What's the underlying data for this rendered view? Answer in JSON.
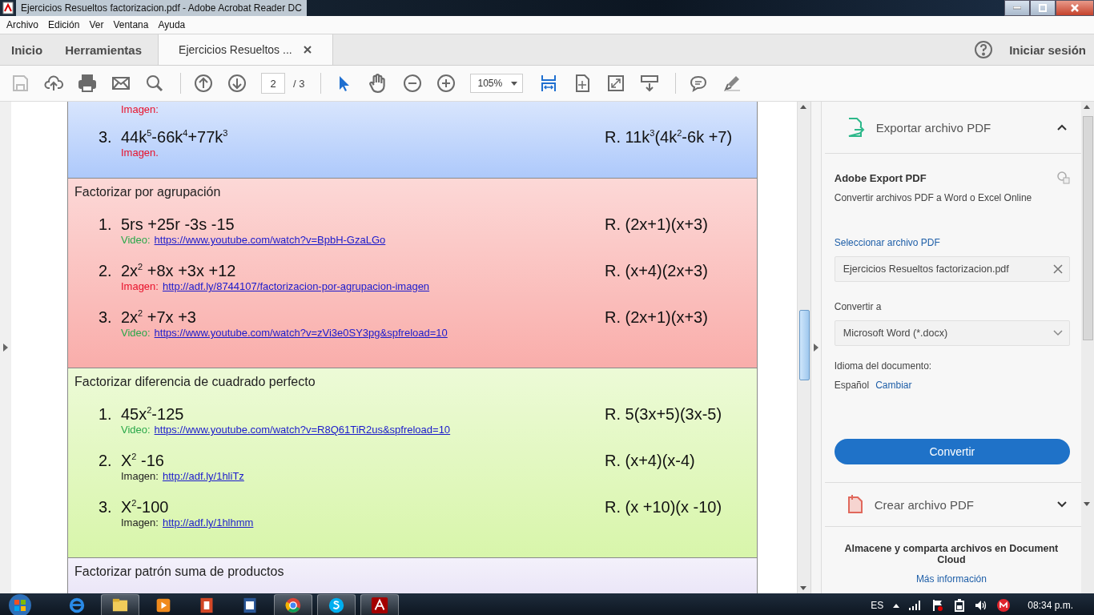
{
  "window": {
    "title": "Ejercicios Resueltos factorizacion.pdf - Adobe Acrobat Reader DC"
  },
  "menu": [
    "Archivo",
    "Edición",
    "Ver",
    "Ventana",
    "Ayuda"
  ],
  "tabs": [
    {
      "label": "Inicio",
      "selected": false
    },
    {
      "label": "Herramientas",
      "selected": false
    },
    {
      "label": "Ejercicios Resueltos ...",
      "selected": true
    }
  ],
  "sign_in": "Iniciar sesión",
  "toolbar": {
    "page": "2",
    "page_total": "/ 3",
    "zoom": "105%"
  },
  "document": {
    "sections": [
      {
        "color": "#a9c6fb",
        "items": [
          {
            "link_label": "Imagen:",
            "color": "#e8102a"
          },
          {
            "number": "3.",
            "formula": "44k$^{5}$-66k$^{4}$+77k$^{3}$",
            "answer": "R. 11k$^{3}$(4k$^{2}$-6k +7)",
            "link_label": "Imagen.",
            "color": "#e8102a"
          }
        ]
      },
      {
        "color": "#f9a9a6",
        "title": "Factorizar por agrupación",
        "items": [
          {
            "number": "1.",
            "formula": "5rs +25r -3s -15",
            "answer": "R. (2x+1)(x+3)",
            "link_label": "Video:",
            "color": "#2aa84a",
            "url": "https://www.youtube.com/watch?v=BpbH-GzaLGo"
          },
          {
            "number": "2.",
            "formula": "2x$^{2}$ +8x +3x +12",
            "answer": "R. (x+4)(2x+3)",
            "link_label": "Imagen:",
            "color": "#e8102a",
            "url": "http://adf.ly/8744107/factorizacion-por-agrupacion-imagen"
          },
          {
            "number": "3.",
            "formula": "2x$^{2}$ +7x +3",
            "answer": "R. (2x+1)(x+3)",
            "link_label": "Video:",
            "color": "#2aa84a",
            "url": "https://www.youtube.com/watch?v=zVi3e0SY3pg&spfreload=10"
          }
        ]
      },
      {
        "color": "#d6f5a6",
        "title": "Factorizar diferencia de cuadrado perfecto",
        "items": [
          {
            "number": "1.",
            "formula": "45x$^{2}$-125",
            "answer": "R. 5(3x+5)(3x-5)",
            "link_label": "Video:",
            "color": "#2aa84a",
            "url": "https://www.youtube.com/watch?v=R8Q61TiR2us&spfreload=10"
          },
          {
            "number": "2.",
            "formula": "X$^{2}$ -16",
            "answer": "R. (x+4)(x-4)",
            "link_label": "Imagen:",
            "color": "#222222",
            "url": "http://adf.ly/1hliTz"
          },
          {
            "number": "3.",
            "formula": "X$^{2}$-100",
            "answer": "R. (x +10)(x -10)",
            "link_label": "Imagen:",
            "color": "#222222",
            "url": "http://adf.ly/1hlhmm"
          }
        ]
      },
      {
        "color": "#e6e0f6",
        "title": "Factorizar patrón suma de productos"
      }
    ]
  },
  "panel": {
    "export_header": "Exportar archivo PDF",
    "export_expanded": true,
    "service_title": "Adobe Export PDF",
    "description": "Convertir archivos PDF a Word o Excel Online",
    "select_link": "Seleccionar archivo PDF",
    "file_value": "Ejercicios Resueltos factorizacion.pdf",
    "convert_to_label": "Convertir a",
    "format_value": "Microsoft Word (*.docx)",
    "language_label": "Idioma del documento:",
    "language": "Español",
    "change_link": "Cambiar",
    "convert_button": "Convertir",
    "create_header": "Crear archivo PDF",
    "create_expanded": false,
    "footer_text": "Almacene y comparta archivos en Document Cloud",
    "more_link": "Más información"
  },
  "taskbar": {
    "apps": [
      {
        "kind": "ie",
        "running": false
      },
      {
        "kind": "explorer",
        "running": true
      },
      {
        "kind": "media",
        "running": false
      },
      {
        "kind": "powerpoint",
        "running": false
      },
      {
        "kind": "word",
        "running": false
      },
      {
        "kind": "chrome",
        "running": true
      },
      {
        "kind": "skype",
        "running": true
      },
      {
        "kind": "acrobat",
        "running": true
      }
    ],
    "language": "ES",
    "time": "08:34 p.m."
  }
}
